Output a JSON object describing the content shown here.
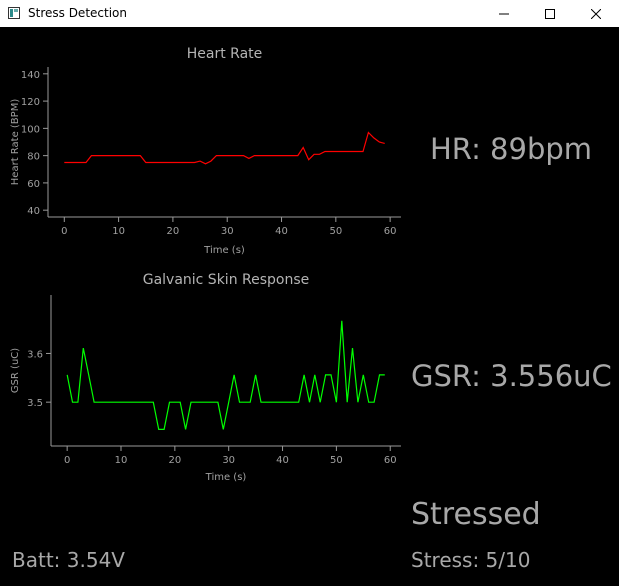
{
  "window": {
    "title": "Stress Detection",
    "icons": {
      "app": "app-icon",
      "minimize": "minimize-icon",
      "maximize": "maximize-icon",
      "close": "close-icon"
    }
  },
  "readouts": {
    "hr": "HR: 89bpm",
    "gsr": "GSR: 3.556uC",
    "status": "Stressed",
    "battery": "Batt: 3.54V",
    "stress": "Stress: 5/10"
  },
  "chart_data": [
    {
      "type": "line",
      "title": "Heart Rate",
      "xlabel": "Time (s)",
      "ylabel": "Heart Rate (BPM)",
      "xlim": [
        -3,
        62
      ],
      "ylim": [
        35,
        145
      ],
      "x_ticks": [
        "0",
        "10",
        "20",
        "30",
        "40",
        "50",
        "60"
      ],
      "y_ticks": [
        "40",
        "60",
        "80",
        "100",
        "120",
        "140"
      ],
      "color": "#ff0000",
      "series": [
        {
          "x": [
            0,
            1,
            2,
            3,
            4,
            5,
            6,
            7,
            8,
            9,
            10,
            11,
            12,
            13,
            14,
            15,
            16,
            17,
            18,
            19,
            20,
            21,
            22,
            23,
            24,
            25,
            26,
            27,
            28,
            29,
            30,
            31,
            32,
            33,
            34,
            35,
            36,
            37,
            38,
            39,
            40,
            41,
            42,
            43,
            44,
            45,
            46,
            47,
            48,
            49,
            50,
            51,
            52,
            53,
            54,
            55,
            56,
            57,
            58,
            59
          ],
          "y": [
            75,
            75,
            75,
            75,
            75,
            80,
            80,
            80,
            80,
            80,
            80,
            80,
            80,
            80,
            80,
            75,
            75,
            75,
            75,
            75,
            75,
            75,
            75,
            75,
            75,
            76,
            74,
            76,
            80,
            80,
            80,
            80,
            80,
            80,
            78,
            80,
            80,
            80,
            80,
            80,
            80,
            80,
            80,
            80,
            86,
            77,
            81,
            81,
            83,
            83,
            83,
            83,
            83,
            83,
            83,
            83,
            97,
            93,
            90,
            89
          ]
        }
      ]
    },
    {
      "type": "line",
      "title": "Galvanic Skin Response",
      "xlabel": "Time (s)",
      "ylabel": "GSR (uC)",
      "xlim": [
        -3,
        62
      ],
      "ylim": [
        3.41,
        3.72
      ],
      "x_ticks": [
        "0",
        "10",
        "20",
        "30",
        "40",
        "50",
        "60"
      ],
      "y_ticks": [
        "3.5",
        "3.6"
      ],
      "color": "#00ff00",
      "series": [
        {
          "x": [
            0,
            1,
            2,
            3,
            4,
            5,
            6,
            7,
            8,
            9,
            10,
            11,
            12,
            13,
            14,
            15,
            16,
            17,
            18,
            19,
            20,
            21,
            22,
            23,
            24,
            25,
            26,
            27,
            28,
            29,
            30,
            31,
            32,
            33,
            34,
            35,
            36,
            37,
            38,
            39,
            40,
            41,
            42,
            43,
            44,
            45,
            46,
            47,
            48,
            49,
            50,
            51,
            52,
            53,
            54,
            55,
            56,
            57,
            58,
            59
          ],
          "y": [
            3.556,
            3.5,
            3.5,
            3.611,
            3.556,
            3.5,
            3.5,
            3.5,
            3.5,
            3.5,
            3.5,
            3.5,
            3.5,
            3.5,
            3.5,
            3.5,
            3.5,
            3.444,
            3.444,
            3.5,
            3.5,
            3.5,
            3.444,
            3.5,
            3.5,
            3.5,
            3.5,
            3.5,
            3.5,
            3.444,
            3.5,
            3.556,
            3.5,
            3.5,
            3.5,
            3.556,
            3.5,
            3.5,
            3.5,
            3.5,
            3.5,
            3.5,
            3.5,
            3.5,
            3.556,
            3.5,
            3.556,
            3.5,
            3.556,
            3.556,
            3.5,
            3.667,
            3.5,
            3.611,
            3.5,
            3.556,
            3.5,
            3.5,
            3.556,
            3.556
          ]
        }
      ]
    }
  ]
}
